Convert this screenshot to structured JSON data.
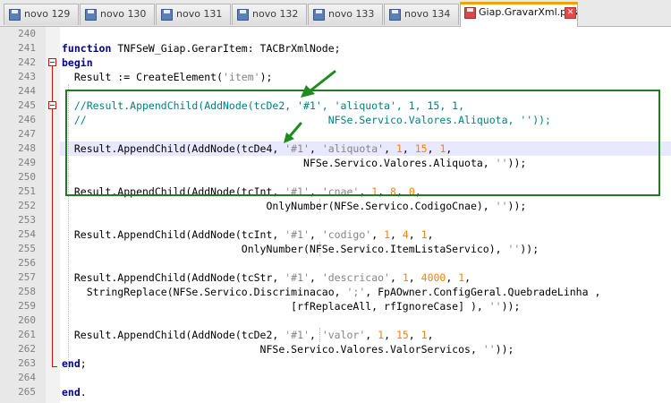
{
  "tabs": [
    {
      "label": "novo 129",
      "active": false
    },
    {
      "label": "novo 130",
      "active": false
    },
    {
      "label": "novo 131",
      "active": false
    },
    {
      "label": "novo 132",
      "active": false
    },
    {
      "label": "novo 133",
      "active": false
    },
    {
      "label": "novo 134",
      "active": false
    },
    {
      "label": "Giap.GravarXml.pas",
      "active": true
    }
  ],
  "colors": {
    "keyword": "#00008b",
    "string": "#848484",
    "number": "#ff8000",
    "comment": "#008080",
    "annotation_box": "#1e7e1e",
    "fold_marker": "#d01010",
    "active_tab_accent": "#f7a000"
  },
  "icons": [
    "save-icon",
    "close-icon",
    "fold-minus-icon",
    "arrow-icon"
  ],
  "line_numbers": [
    "240",
    "241",
    "242",
    "243",
    "244",
    "245",
    "246",
    "247",
    "248",
    "249",
    "250",
    "251",
    "252",
    "253",
    "254",
    "255",
    "256",
    "257",
    "258",
    "259",
    "260",
    "261",
    "262",
    "263",
    "264",
    "265"
  ],
  "code_lines": [
    {
      "num": "240",
      "parts": []
    },
    {
      "num": "241",
      "parts": [
        [
          "kw",
          "function "
        ],
        [
          "",
          "TNFSeW_Giap.GerarItem: TACBrXmlNode;"
        ]
      ]
    },
    {
      "num": "242",
      "parts": [
        [
          "kw",
          "begin"
        ]
      ]
    },
    {
      "num": "243",
      "parts": [
        [
          "",
          "  Result := CreateElement("
        ],
        [
          "str",
          "'item'"
        ],
        [
          "",
          ");"
        ]
      ]
    },
    {
      "num": "244",
      "parts": []
    },
    {
      "num": "245",
      "parts": [
        [
          "cm",
          "  //Result.AppendChild(AddNode(tcDe2, '#1', 'aliquota', 1, 15, 1,"
        ]
      ]
    },
    {
      "num": "246",
      "parts": [
        [
          "cm",
          "  //                                       NFSe.Servico.Valores.Aliquota, ''));"
        ]
      ]
    },
    {
      "num": "247",
      "parts": []
    },
    {
      "num": "248",
      "parts": [
        [
          "",
          "  Result.AppendChild(AddNode(tcDe4, "
        ],
        [
          "str",
          "'#1'"
        ],
        [
          "",
          ", "
        ],
        [
          "str",
          "'aliquota'"
        ],
        [
          "",
          ", "
        ],
        [
          "num",
          "1"
        ],
        [
          "",
          ", "
        ],
        [
          "num",
          "15"
        ],
        [
          "",
          ", "
        ],
        [
          "num",
          "1"
        ],
        [
          "",
          ","
        ]
      ]
    },
    {
      "num": "249",
      "parts": [
        [
          "",
          "                                       NFSe.Servico.Valores.Aliquota, "
        ],
        [
          "str",
          "''"
        ],
        [
          "",
          "));"
        ]
      ]
    },
    {
      "num": "250",
      "parts": []
    },
    {
      "num": "251",
      "parts": [
        [
          "",
          "  Result.AppendChild(AddNode(tcInt, "
        ],
        [
          "str",
          "'#1'"
        ],
        [
          "",
          ", "
        ],
        [
          "str",
          "'cnae'"
        ],
        [
          "",
          ", "
        ],
        [
          "num",
          "1"
        ],
        [
          "",
          ", "
        ],
        [
          "num",
          "8"
        ],
        [
          "",
          ", "
        ],
        [
          "num",
          "0"
        ],
        [
          "",
          ","
        ]
      ]
    },
    {
      "num": "252",
      "parts": [
        [
          "",
          "                                 OnlyNumber(NFSe.Servico.CodigoCnae), "
        ],
        [
          "str",
          "''"
        ],
        [
          "",
          "));"
        ]
      ]
    },
    {
      "num": "253",
      "parts": []
    },
    {
      "num": "254",
      "parts": [
        [
          "",
          "  Result.AppendChild(AddNode(tcInt, "
        ],
        [
          "str",
          "'#1'"
        ],
        [
          "",
          ", "
        ],
        [
          "str",
          "'codigo'"
        ],
        [
          "",
          ", "
        ],
        [
          "num",
          "1"
        ],
        [
          "",
          ", "
        ],
        [
          "num",
          "4"
        ],
        [
          "",
          ", "
        ],
        [
          "num",
          "1"
        ],
        [
          "",
          ","
        ]
      ]
    },
    {
      "num": "255",
      "parts": [
        [
          "",
          "                             OnlyNumber(NFSe.Servico.ItemListaServico), "
        ],
        [
          "str",
          "''"
        ],
        [
          "",
          "));"
        ]
      ]
    },
    {
      "num": "256",
      "parts": []
    },
    {
      "num": "257",
      "parts": [
        [
          "",
          "  Result.AppendChild(AddNode(tcStr, "
        ],
        [
          "str",
          "'#1'"
        ],
        [
          "",
          ", "
        ],
        [
          "str",
          "'descricao'"
        ],
        [
          "",
          ", "
        ],
        [
          "num",
          "1"
        ],
        [
          "",
          ", "
        ],
        [
          "num",
          "4000"
        ],
        [
          "",
          ", "
        ],
        [
          "num",
          "1"
        ],
        [
          "",
          ","
        ]
      ]
    },
    {
      "num": "258",
      "parts": [
        [
          "",
          "    StringReplace(NFSe.Servico.Discriminacao, "
        ],
        [
          "str",
          "';'"
        ],
        [
          "",
          ", FpAOwner.ConfigGeral.QuebradeLinha ,"
        ]
      ]
    },
    {
      "num": "259",
      "parts": [
        [
          "",
          "                                     [rfReplaceAll, rfIgnoreCase] ), "
        ],
        [
          "str",
          "''"
        ],
        [
          "",
          "));"
        ]
      ]
    },
    {
      "num": "260",
      "parts": []
    },
    {
      "num": "261",
      "parts": [
        [
          "",
          "  Result.AppendChild(AddNode(tcDe2, "
        ],
        [
          "str",
          "'#1'"
        ],
        [
          "",
          ", "
        ],
        [
          "str",
          "'valor'"
        ],
        [
          "",
          ", "
        ],
        [
          "num",
          "1"
        ],
        [
          "",
          ", "
        ],
        [
          "num",
          "15"
        ],
        [
          "",
          ", "
        ],
        [
          "num",
          "1"
        ],
        [
          "",
          ","
        ]
      ]
    },
    {
      "num": "262",
      "parts": [
        [
          "",
          "                                NFSe.Servico.Valores.ValorServicos, "
        ],
        [
          "str",
          "''"
        ],
        [
          "",
          "));"
        ]
      ]
    },
    {
      "num": "263",
      "parts": [
        [
          "kw",
          "end"
        ],
        [
          "",
          ";"
        ]
      ]
    },
    {
      "num": "264",
      "parts": []
    },
    {
      "num": "265",
      "parts": [
        [
          "kw",
          "end"
        ],
        [
          "",
          "."
        ]
      ]
    }
  ]
}
